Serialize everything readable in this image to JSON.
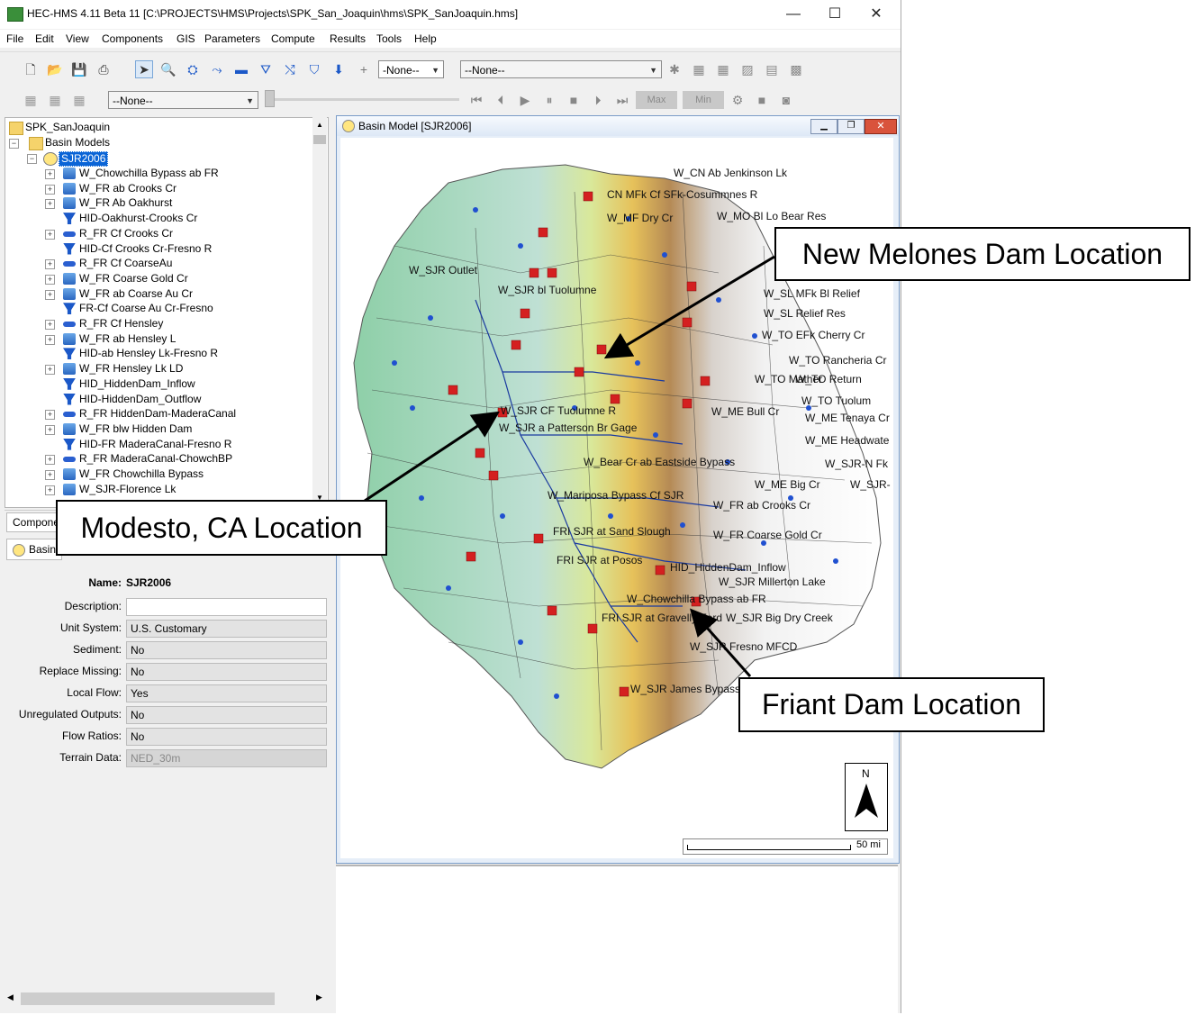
{
  "window": {
    "title": "HEC-HMS 4.11 Beta 11 [C:\\PROJECTS\\HMS\\Projects\\SPK_San_Joaquin\\hms\\SPK_SanJoaquin.hms]",
    "minimize": "—",
    "maximize": "☐",
    "close": "✕"
  },
  "menu": [
    "File",
    "Edit",
    "View",
    "Components",
    "GIS",
    "Parameters",
    "Compute",
    "Results",
    "Tools",
    "Help"
  ],
  "toolbar": {
    "combo1": "-None--",
    "combo2": "--None--",
    "combo3": "--None--",
    "max_label": "Max",
    "min_label": "Min"
  },
  "tree": {
    "root": "SPK_SanJoaquin",
    "folder": "Basin Models",
    "basin": "SJR2006",
    "items": [
      {
        "label": "W_Chowchilla Bypass ab FR",
        "type": "sub"
      },
      {
        "label": "W_FR ab Crooks Cr",
        "type": "sub"
      },
      {
        "label": "W_FR Ab Oakhurst",
        "type": "sub"
      },
      {
        "label": "HID-Oakhurst-Crooks Cr",
        "type": "div"
      },
      {
        "label": "R_FR Cf Crooks Cr",
        "type": "reach"
      },
      {
        "label": "HID-Cf Crooks Cr-Fresno R",
        "type": "div"
      },
      {
        "label": "R_FR Cf CoarseAu",
        "type": "reach"
      },
      {
        "label": "W_FR Coarse Gold Cr",
        "type": "sub"
      },
      {
        "label": "W_FR ab Coarse Au Cr",
        "type": "sub"
      },
      {
        "label": "FR-Cf Coarse Au Cr-Fresno",
        "type": "div"
      },
      {
        "label": "R_FR Cf Hensley",
        "type": "reach"
      },
      {
        "label": "W_FR ab Hensley L",
        "type": "sub"
      },
      {
        "label": "HID-ab Hensley Lk-Fresno R",
        "type": "div"
      },
      {
        "label": "W_FR Hensley Lk LD",
        "type": "sub"
      },
      {
        "label": "HID_HiddenDam_Inflow",
        "type": "div"
      },
      {
        "label": "HID-HiddenDam_Outflow",
        "type": "div"
      },
      {
        "label": "R_FR HiddenDam-MaderaCanal",
        "type": "reach"
      },
      {
        "label": "W_FR blw Hidden Dam",
        "type": "sub"
      },
      {
        "label": "HID-FR MaderaCanal-Fresno R",
        "type": "div"
      },
      {
        "label": "R_FR MaderaCanal-ChowchBP",
        "type": "reach"
      },
      {
        "label": "W_FR Chowchilla Bypass",
        "type": "sub"
      },
      {
        "label": "W_SJR-Florence Lk",
        "type": "sub"
      }
    ]
  },
  "tabs": {
    "components": "Compone",
    "basin": "Basin"
  },
  "properties": {
    "name_label": "Name:",
    "name_value": "SJR2006",
    "rows": [
      {
        "label": "Description:",
        "value": ""
      },
      {
        "label": "Unit System:",
        "value": "U.S. Customary"
      },
      {
        "label": "Sediment:",
        "value": "No"
      },
      {
        "label": "Replace Missing:",
        "value": "No"
      },
      {
        "label": "Local Flow:",
        "value": "Yes"
      },
      {
        "label": "Unregulated Outputs:",
        "value": "No"
      },
      {
        "label": "Flow Ratios:",
        "value": "No"
      },
      {
        "label": "Terrain Data:",
        "value": "NED_30m"
      }
    ]
  },
  "basin_window": {
    "title": "Basin Model [SJR2006]",
    "north": "N",
    "scale": "50 mi"
  },
  "map_labels": [
    "W_CN Ab Jenkinson Lk",
    "CN MFk Cf SFk-Cosummnes R",
    "W_MO Bl Lo Bear Res",
    "W_MF Dry Cr",
    "W_SJR Outlet",
    "W_SJR bl Tuolumne",
    "W_SL MFk Bl Relief",
    "W_SL Relief Res",
    "W_TO EFk Cherry Cr",
    "W_TO Rancheria Cr",
    "W_TO Return",
    "W_TO Tuolum",
    "W_ME Tenaya Cr",
    "W_ME Headwate",
    "W_SJR-N Fk",
    "W_SJR-",
    "W_SJR CF Tuolumne R",
    "W_SJR a Patterson Br Gage",
    "W_Bear Cr ab Eastside Bypass",
    "W_Mariposa Bypass Cf SJR",
    "W_FR ab Crooks Cr",
    "W_FR Coarse Gold Cr",
    "FRI SJR at Sand Slough",
    "FRI SJR at Posos",
    "HID_HiddenDam_Inflow",
    "W_SJR Millerton Lake",
    "W_Chowchilla Bypass ab FR",
    "W_SJR Big Dry Creek",
    "FRI SJR at Gravelly Ford",
    "W_SJR Fresno MFCD",
    "W_SJR James Bypass",
    "W_TO Mather",
    "W_ME Bull Cr",
    "W_ME Big Cr"
  ],
  "callouts": {
    "new_melones": "New Melones Dam Location",
    "modesto": "Modesto, CA Location",
    "friant": "Friant Dam Location"
  },
  "colors": {
    "accent": "#0078d7",
    "selection": "#0a64d6",
    "element_red": "#d42020",
    "element_blue": "#2050d0"
  }
}
